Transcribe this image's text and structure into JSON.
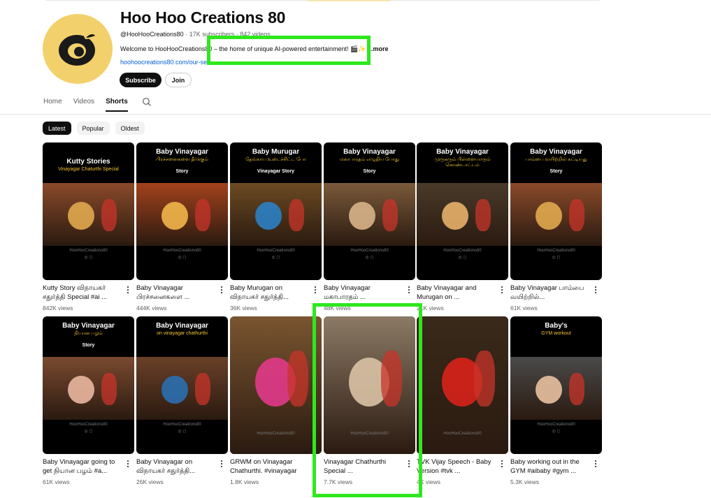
{
  "channel": {
    "name": "Hoo Hoo Creations 80",
    "handle": "@HooHooCreations80",
    "subscribers": "17K subscribers",
    "videos": "842 videos",
    "description": "Welcome to HooHooCreations80 – the home of unique AI-powered entertainment! 🎬✨",
    "more_label": "...more",
    "link": "hoohoocreations80.com/our-se",
    "subscribe_label": "Subscribe",
    "join_label": "Join"
  },
  "tabs": [
    {
      "label": "Home",
      "active": false
    },
    {
      "label": "Videos",
      "active": false
    },
    {
      "label": "Shorts",
      "active": true
    }
  ],
  "chips": [
    {
      "label": "Latest",
      "active": true
    },
    {
      "label": "Popular",
      "active": false
    },
    {
      "label": "Oldest",
      "active": false
    }
  ],
  "watermark": "HooHooCreations80",
  "shorts": [
    {
      "thumb_title": "Kutty Stories",
      "thumb_sub": "Vinayagar Chaturthi Special",
      "thumb_story": "",
      "title": "Kutty Story விநாயகர் சதுர்த்தி Special #ai ...",
      "views": "842K views",
      "scene": "#8a4a2a",
      "accent": "#e0a84e"
    },
    {
      "thumb_title": "Baby Vinayagar",
      "thumb_sub": "பிரச்சனைகளை தீர்க்கும்",
      "thumb_story": "Story",
      "title": "Baby Vinayagar பிரச்சனைகளை ...",
      "views": "444K views",
      "scene": "#a3421c",
      "accent": "#f1b64a"
    },
    {
      "thumb_title": "Baby Murugar",
      "thumb_sub": "தேங்காய உடைச்சிட்ட போ",
      "thumb_story": "Vinayagar Story",
      "title": "Baby Murugan on விநாயகர் சதுர்த்தி...",
      "views": "36K views",
      "scene": "#6b4a22",
      "accent": "#2b7fc4"
    },
    {
      "thumb_title": "Baby Vinayagar",
      "thumb_sub": "மகாபாரதம் எழுதிய போது",
      "thumb_story": "Story",
      "title": "Baby Vinayagar மகாபாரதம் ...",
      "views": "48K views",
      "scene": "#7a5a3a",
      "accent": "#d8b48a"
    },
    {
      "thumb_title": "Baby Vinayagar",
      "thumb_sub": "முருகரும் பிள்ளையாரும் கொண்டாட்டம்",
      "thumb_story": "",
      "title": "Baby Vinayagar and Murugan on ...",
      "views": "21K views",
      "scene": "#4a3a2a",
      "accent": "#e7b06a"
    },
    {
      "thumb_title": "Baby Vinayagar",
      "thumb_sub": "பாம்பை வயிற்றில் கட்டியது",
      "thumb_story": "Story",
      "title": "Baby Vinayagar பாம்பை வயிற்றில்...",
      "views": "61K views",
      "scene": "#8a4a2a",
      "accent": "#e0a84e"
    },
    {
      "thumb_title": "Baby Vinayagar",
      "thumb_sub": "நியான பழம்",
      "thumb_story": "Story",
      "title": "Baby Vinayagar going to get நியான பழம் #a...",
      "views": "61K views",
      "scene": "#7a4a30",
      "accent": "#e9b7a0"
    },
    {
      "thumb_title": "Baby Vinayagar",
      "thumb_sub": "on vinayagar chathurthi",
      "thumb_story": "",
      "title": "Baby Vinayagar on விநாயகர் சதுர்த்தி...",
      "views": "26K views",
      "scene": "#6a4028",
      "accent": "#2a6fb0"
    },
    {
      "thumb_title": "",
      "thumb_sub": "",
      "thumb_story": "",
      "title": "GRWM on Vinayagar Chathurthi. #vinayagar",
      "views": "1.8K views",
      "scene": "#7a5530",
      "accent": "#e23a8a"
    },
    {
      "thumb_title": "",
      "thumb_sub": "",
      "thumb_story": "",
      "title": "Vinayagar Chathurthi Special ...",
      "views": "7.7K views",
      "scene": "#8c7a66",
      "accent": "#d9c2a5"
    },
    {
      "thumb_title": "",
      "thumb_sub": "",
      "thumb_story": "",
      "title": "TVK Vijay Speech - Baby Version #tvk ...",
      "views": "4K views",
      "scene": "#3a2a1a",
      "accent": "#d8221a"
    },
    {
      "thumb_title": "Baby's",
      "thumb_sub": "GYM workout",
      "thumb_story": "",
      "title": "Baby working out in the GYM #aibaby #gym ...",
      "views": "5.3K views",
      "scene": "#4a4a4a",
      "accent": "#e8c0a0"
    }
  ]
}
